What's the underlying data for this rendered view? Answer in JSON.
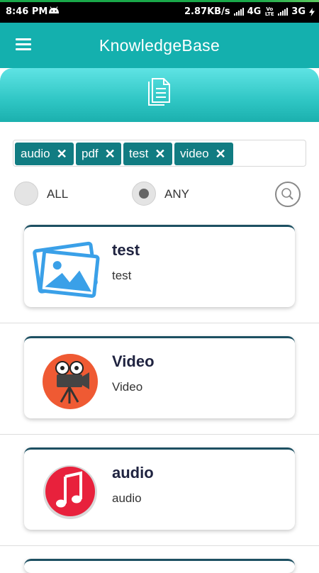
{
  "status_bar": {
    "time": "8:46 PM",
    "network_speed": "2.87KB/s",
    "network_type_1": "4G",
    "carrier_badge": "Vo LTE",
    "network_type_2": "3G",
    "icons": [
      "android-icon",
      "signal-icon",
      "signal-icon",
      "charging-icon"
    ]
  },
  "toolbar": {
    "title": "KnowledgeBase",
    "menu_icon": "hamburger-icon"
  },
  "banner": {
    "icon": "document-icon"
  },
  "tags": {
    "items": [
      {
        "label": "audio"
      },
      {
        "label": "pdf"
      },
      {
        "label": "test"
      },
      {
        "label": "video"
      }
    ],
    "remove_symbol": "✕"
  },
  "filter": {
    "all_label": "ALL",
    "any_label": "ANY",
    "selected": "ANY",
    "search_icon": "search-icon"
  },
  "cards": [
    {
      "title": "test",
      "subtitle": "test",
      "icon": "image-gallery-icon"
    },
    {
      "title": "Video",
      "subtitle": "Video",
      "icon": "movie-camera-icon"
    },
    {
      "title": "audio",
      "subtitle": "audio",
      "icon": "music-note-icon"
    }
  ],
  "colors": {
    "primary": "#14b0ae",
    "chip": "#117c82",
    "card_border": "#1d5062"
  }
}
